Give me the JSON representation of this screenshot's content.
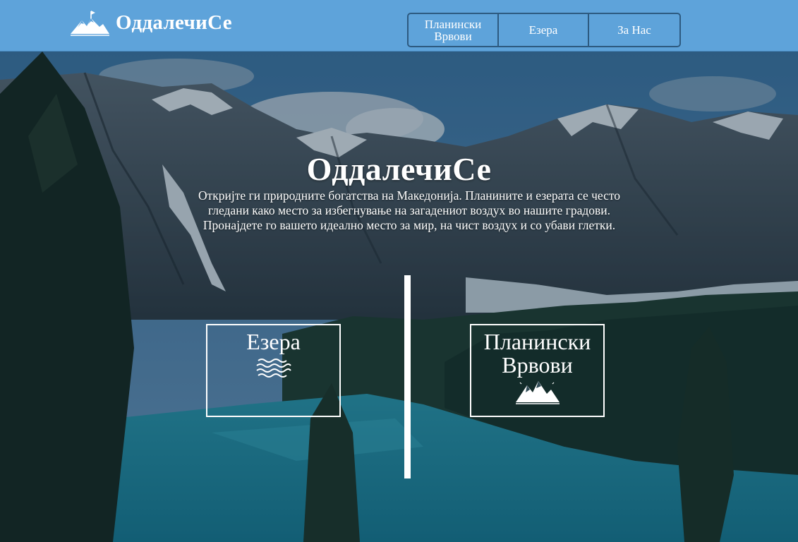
{
  "header": {
    "logo_text": "ОддалечиСе",
    "logo_icon": "mountain-flag-icon",
    "nav": [
      {
        "label": "Планински Врвови"
      },
      {
        "label": "Езера"
      },
      {
        "label": "За Нас"
      }
    ]
  },
  "hero": {
    "background": "mountain-lake-photo",
    "title": "ОддалечиСе",
    "description": "Откријте ги природните богатства на Македонија. Планините и езерата се често гледани како место за избегнување на загадениот воздух во нашите градови. Пронајдете го вашето идеално место за мир, на чист воздух и со убави глетки.",
    "cards": [
      {
        "label": "Езера",
        "icon": "waves-icon"
      },
      {
        "label": "Планински Врвови",
        "icon": "mountain-peaks-icon"
      }
    ]
  },
  "colors": {
    "header_bg": "#5ea3da",
    "nav_border": "#2d5a80",
    "text": "#ffffff"
  }
}
